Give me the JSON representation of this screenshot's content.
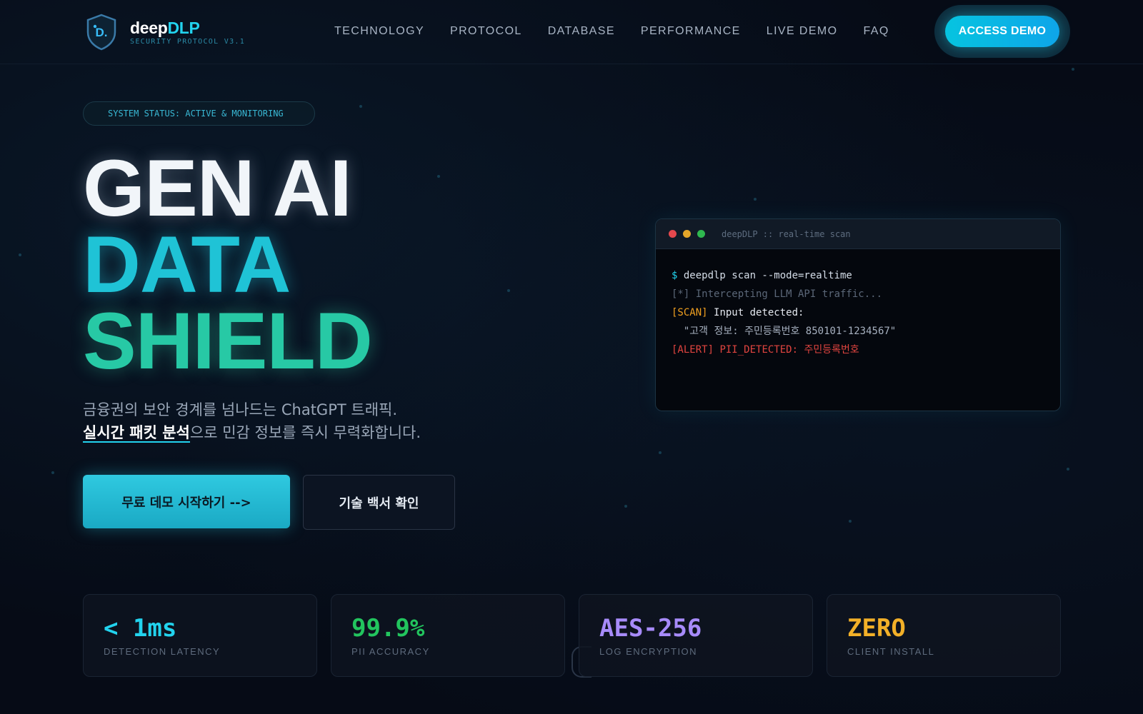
{
  "nav": {
    "logo_prefix": "deep",
    "logo_highlight": "DLP",
    "logo_subtitle": "SECURITY PROTOCOL V3.1",
    "menu": [
      "TECHNOLOGY",
      "PROTOCOL",
      "DATABASE",
      "PERFORMANCE",
      "LIVE DEMO",
      "FAQ"
    ],
    "cta": "ACCESS DEMO"
  },
  "hero": {
    "status": "SYSTEM STATUS: ACTIVE & MONITORING",
    "headline": [
      "GEN AI",
      "DATA",
      "SHIELD"
    ],
    "desc_line1": "금융권의 보안 경계를 넘나드는 ChatGPT 트래픽.",
    "desc_strong": "실시간 패킷 분석",
    "desc_line2_rest": "으로 민감 정보를 즉시 무력화합니다.",
    "primary_button": "무료 데모 시작하기  -->",
    "secondary_button": "기술 백서 확인"
  },
  "terminal": {
    "title": "deepDLP :: real-time scan",
    "lines": [
      {
        "prefix": "$ ",
        "text": "deepdlp scan --mode=realtime"
      },
      {
        "text": "[*] Intercepting LLM API traffic..."
      },
      {
        "prefix": "[SCAN] ",
        "text": "Input detected:"
      },
      {
        "text": "  \"고객 정보: 주민등록번호 850101-1234567\""
      },
      {
        "prefix": "[ALERT] ",
        "text": "PII_DETECTED: 주민등록번호"
      }
    ]
  },
  "stats": [
    {
      "value": "< 1ms",
      "label": "DETECTION LATENCY",
      "color": "#22d3ee"
    },
    {
      "value": "99.9%",
      "label": "PII ACCURACY",
      "color": "#22c55e"
    },
    {
      "value": "AES-256",
      "label": "LOG ENCRYPTION",
      "color": "#a78bfa"
    },
    {
      "value": "ZERO",
      "label": "CLIENT INSTALL",
      "color": "#f2b028"
    }
  ],
  "colors": {
    "accent": "#22d3ee",
    "background": "#060b16",
    "alert": "#e0443f",
    "scan": "#f0a020"
  },
  "icons": {
    "logo": "shield-icon",
    "window_controls": [
      "close-dot-icon",
      "minimize-dot-icon",
      "maximize-dot-icon"
    ]
  }
}
